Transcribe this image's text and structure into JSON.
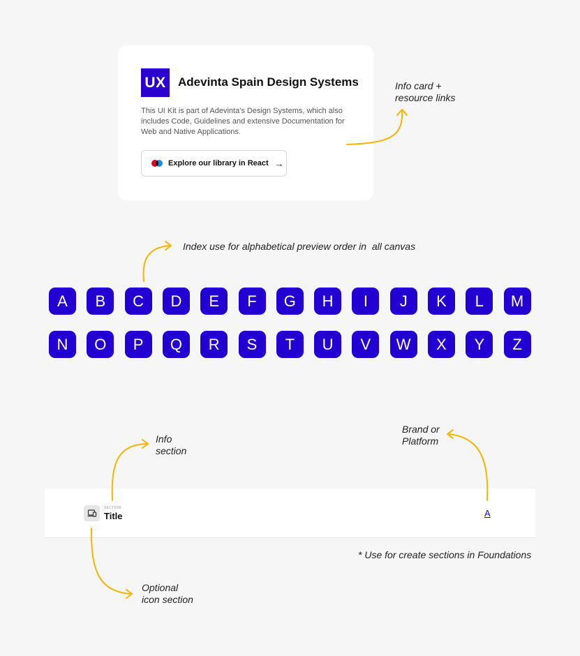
{
  "info_card": {
    "logo": "UX",
    "title": "Adevinta Spain Design Systems",
    "description": "This UI Kit is part of Adevinta's Design Systems, which also includes Code, Guidelines and extensive Documentation for Web and Native Applications.",
    "button_label": "Explore our library in React",
    "button_arrow": "→",
    "icon": "library-icon"
  },
  "annotations": {
    "info_card_line1": "Info card +",
    "info_card_line2": "resource links",
    "index_note": "Index use for alphabetical preview order in  all canvas",
    "info_section_line1": "Info",
    "info_section_line2": "section",
    "brand_line1": "Brand or",
    "brand_line2": "Platform",
    "foundations_note": "* Use for create sections in Foundations",
    "optional_line1": "Optional",
    "optional_line2": "icon section"
  },
  "letters": {
    "row1": [
      "A",
      "B",
      "C",
      "D",
      "E",
      "F",
      "G",
      "H",
      "I",
      "J",
      "K",
      "L",
      "M"
    ],
    "row2": [
      "N",
      "O",
      "P",
      "Q",
      "R",
      "S",
      "T",
      "U",
      "V",
      "W",
      "X",
      "Y",
      "Z"
    ]
  },
  "section_header": {
    "eyebrow": "SECTION",
    "title": "Title",
    "brand": "A",
    "icon": "device-icon"
  },
  "colors": {
    "accent": "#2200d2",
    "arrow": "#f5b400",
    "background": "#f6f6f6"
  }
}
